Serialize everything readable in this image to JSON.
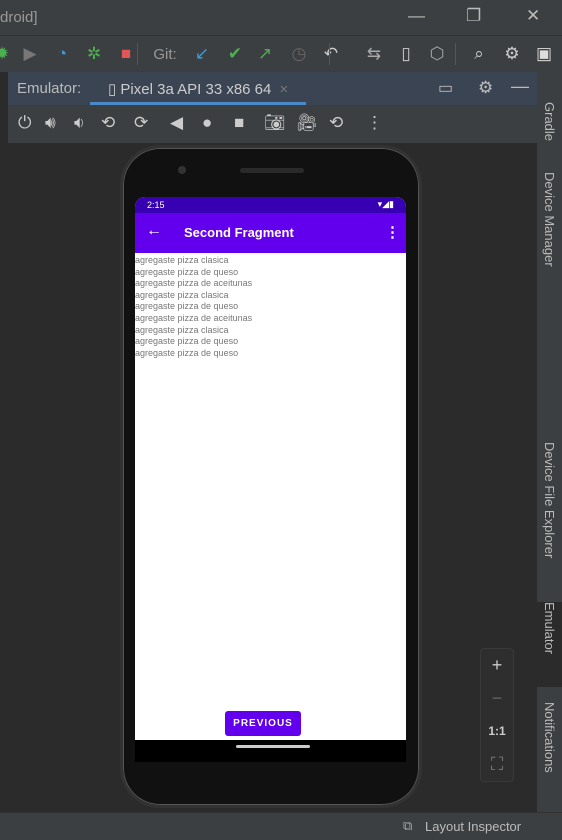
{
  "window": {
    "title": "droid]",
    "minimize": "—",
    "restore": "❐",
    "close": "✕"
  },
  "toolbar": {
    "git_label": "Git:"
  },
  "emulator": {
    "label": "Emulator:",
    "tab": "Pixel 3a API 33 x86 64",
    "tab_close": "×"
  },
  "side_tabs": [
    "Gradle",
    "Device Manager",
    "Device File Explorer",
    "Emulator",
    "Notifications"
  ],
  "device": {
    "time": "2:15",
    "title": "Second Fragment",
    "items": [
      "agregaste pizza clasica",
      "agregaste pizza de queso",
      "agregaste pizza de aceitunas",
      "agregaste pizza clasica",
      "agregaste pizza de queso",
      "agregaste pizza de aceitunas",
      "agregaste pizza clasica",
      "agregaste pizza de queso",
      "agregaste pizza de queso"
    ],
    "button": "PREVIOUS"
  },
  "zoom": {
    "in": "+",
    "out": "−",
    "actual": "1:1",
    "fit": "⛶"
  },
  "status": {
    "layout_inspector": "Layout Inspector"
  }
}
